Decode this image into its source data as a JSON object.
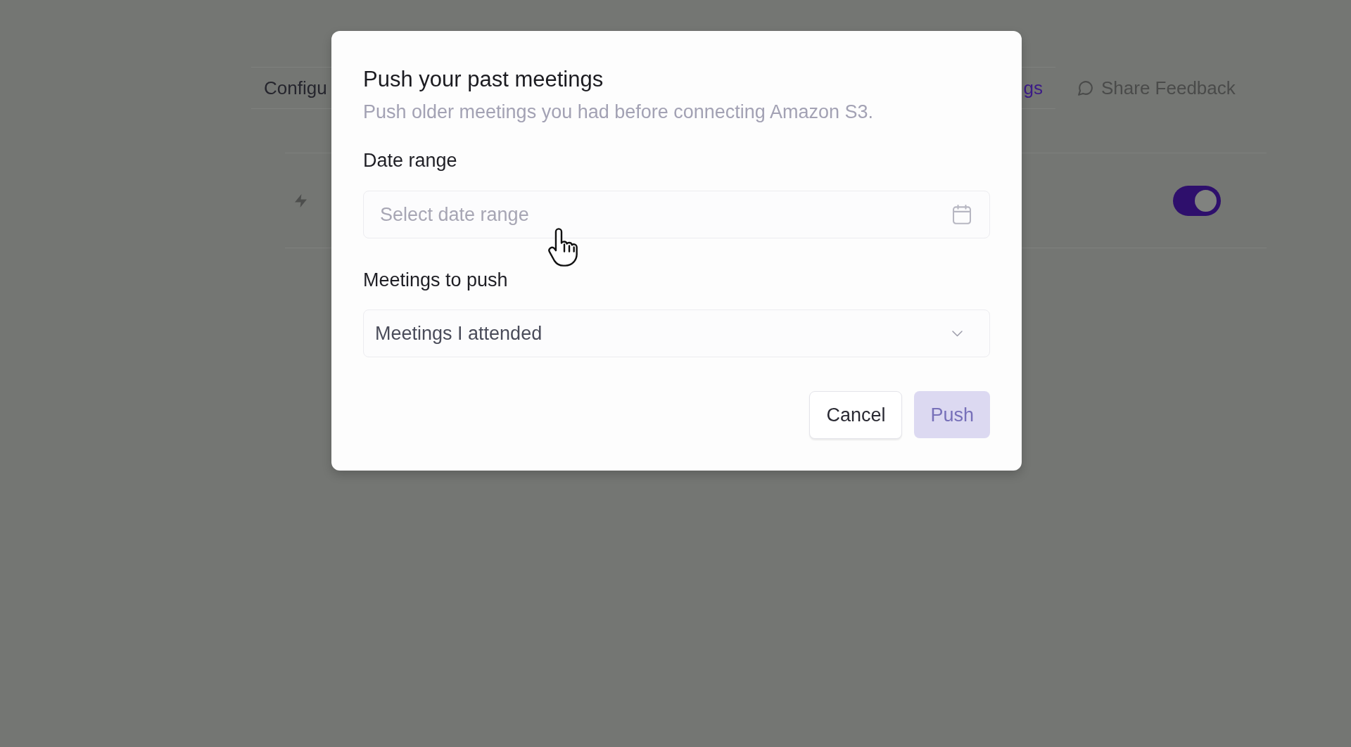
{
  "page": {
    "tabs": [
      {
        "label": "Configu",
        "selected": false
      },
      {
        "label": "gs",
        "selected": true
      }
    ],
    "feedback_link": {
      "label": "Share Feedback"
    },
    "settings_row": {
      "toggle": {
        "on": true
      }
    }
  },
  "dialog": {
    "title": "Push your past meetings",
    "subtitle": "Push older meetings you had before connecting Amazon S3.",
    "fields": [
      {
        "kind": "date",
        "label": "Date range",
        "placeholder": "Select date range"
      },
      {
        "kind": "select",
        "label": "Meetings to push",
        "value": "Meetings I attended"
      }
    ],
    "buttons": [
      {
        "label": "Cancel",
        "kind": "secondary",
        "disabled": false
      },
      {
        "label": "Push",
        "kind": "primary",
        "disabled": true
      }
    ]
  }
}
